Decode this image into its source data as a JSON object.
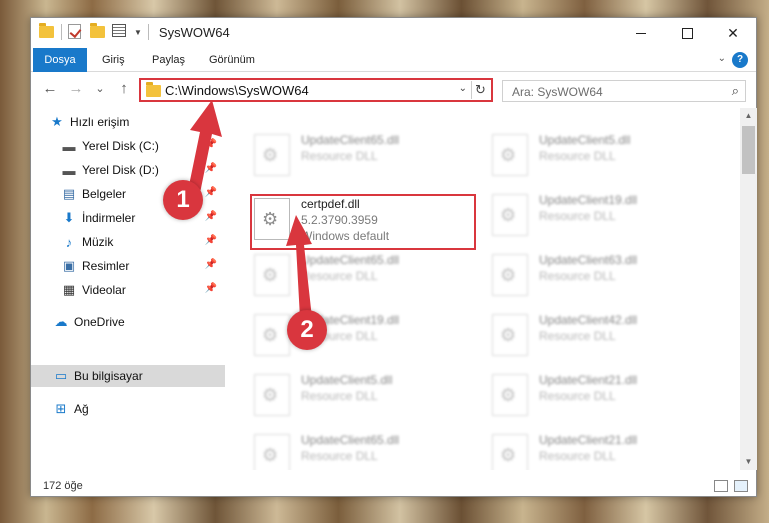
{
  "window": {
    "title": "SysWOW64",
    "controls": {
      "minimize": "—",
      "maximize": "☐",
      "close": "✕"
    }
  },
  "ribbon": {
    "tabs": [
      "Dosya",
      "Giriş",
      "Paylaş",
      "Görünüm"
    ],
    "help": "?",
    "collapse": "⌄"
  },
  "nav": {
    "back": "←",
    "forward": "→",
    "recent": "⌄",
    "up": "↑"
  },
  "address": {
    "path": "C:\\Windows\\SysWOW64",
    "dropdown": "⌄",
    "refresh": "↻"
  },
  "search": {
    "placeholder": "Ara: SysWOW64",
    "icon": "⌕"
  },
  "sidebar": {
    "items": [
      {
        "label": "Hızlı erişim",
        "icon": "star-icon",
        "glyph": "★",
        "color": "#1979ca"
      },
      {
        "label": "Yerel Disk (C:)",
        "icon": "drive-icon",
        "glyph": "▬",
        "color": "#555555",
        "pinned": true
      },
      {
        "label": "Yerel Disk (D:)",
        "icon": "drive-icon",
        "glyph": "▬",
        "color": "#555555",
        "pinned": true
      },
      {
        "label": "Belgeler",
        "icon": "documents-icon",
        "glyph": "▤",
        "color": "#3a6ea5",
        "pinned": true
      },
      {
        "label": "İndirmeler",
        "icon": "download-icon",
        "glyph": "⬇",
        "color": "#1979ca",
        "pinned": true
      },
      {
        "label": "Müzik",
        "icon": "music-icon",
        "glyph": "♪",
        "color": "#1979ca",
        "pinned": true
      },
      {
        "label": "Resimler",
        "icon": "pictures-icon",
        "glyph": "▣",
        "color": "#3a6ea5",
        "pinned": true
      },
      {
        "label": "Videolar",
        "icon": "videos-icon",
        "glyph": "▦",
        "color": "#333333",
        "pinned": true
      },
      {
        "label": "OneDrive",
        "icon": "cloud-icon",
        "glyph": "☁",
        "color": "#1979ca"
      },
      {
        "label": "Bu bilgisayar",
        "icon": "computer-icon",
        "glyph": "▭",
        "color": "#1979ca",
        "selected": true
      },
      {
        "label": "Ağ",
        "icon": "network-icon",
        "glyph": "⊞",
        "color": "#1979ca"
      }
    ],
    "pin_glyph": "📌"
  },
  "files": {
    "highlighted": {
      "name": "certpdef.dll",
      "version": "5.2.3790.3959",
      "company": "Windows default"
    },
    "blurred": [
      {
        "name": "UpdateClient65.dll",
        "desc": "Resource DLL"
      },
      {
        "name": "UpdateClient5.dll",
        "desc": "Resource DLL"
      },
      {
        "name": "UpdateClient19.dll",
        "desc": "Resource DLL"
      },
      {
        "name": "UpdateClient65.dll",
        "desc": "Resource DLL"
      },
      {
        "name": "UpdateClient63.dll",
        "desc": "Resource DLL"
      },
      {
        "name": "UpdateClient19.dll",
        "desc": "Resource DLL"
      },
      {
        "name": "UpdateClient42.dll",
        "desc": "Resource DLL"
      },
      {
        "name": "UpdateClient5.dll",
        "desc": "Resource DLL"
      },
      {
        "name": "UpdateClient21.dll",
        "desc": "Resource DLL"
      },
      {
        "name": "UpdateClient65.dll",
        "desc": "Resource DLL"
      },
      {
        "name": "UpdateClient21.dll",
        "desc": "Resource DLL"
      }
    ]
  },
  "status": {
    "count": "172 öğe"
  },
  "annotations": {
    "step1": "1",
    "step2": "2",
    "color": "#d9363e"
  }
}
